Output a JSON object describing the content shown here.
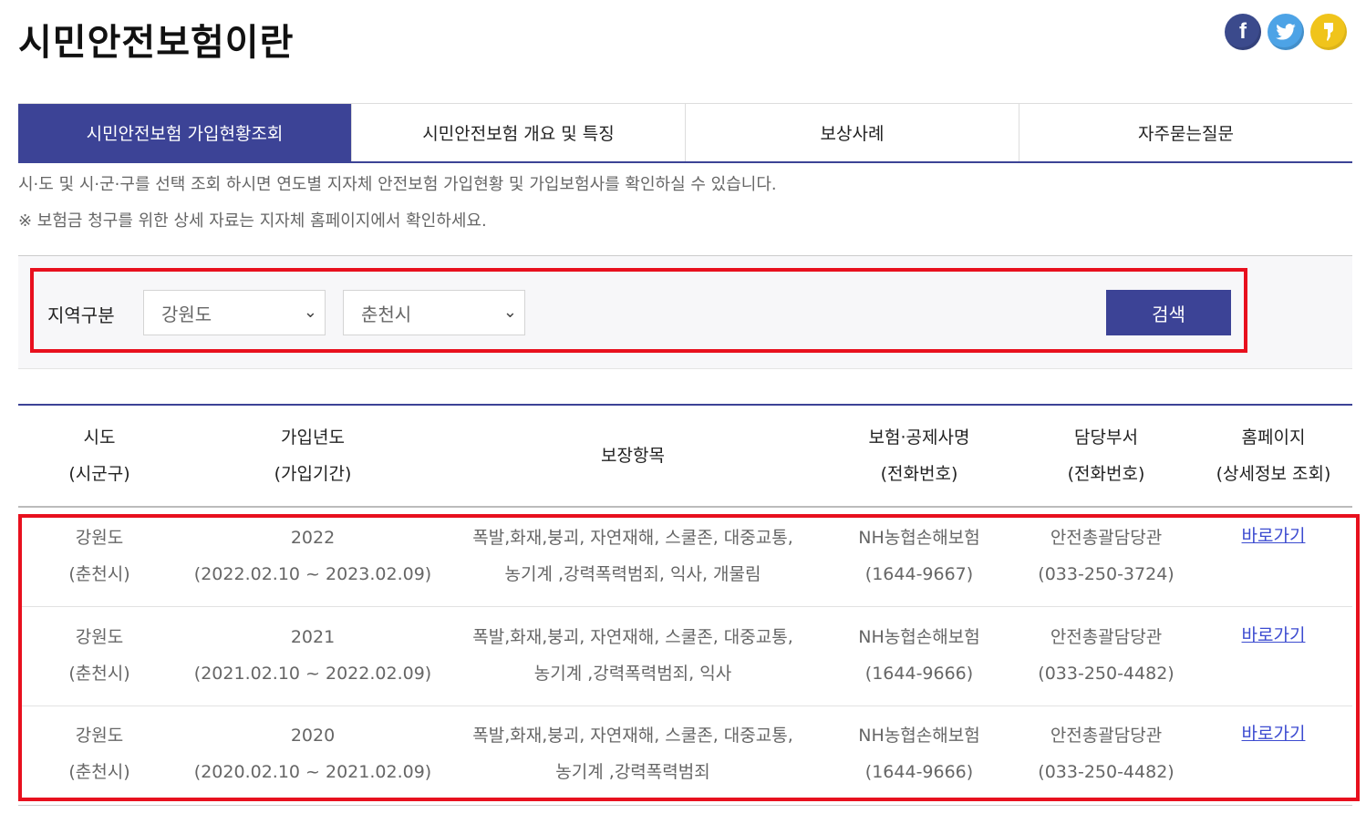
{
  "page": {
    "title": "시민안전보험이란"
  },
  "social": {
    "facebook": "f",
    "twitter": "t",
    "kakao": "k"
  },
  "tabs": [
    {
      "label": "시민안전보험 가입현황조회",
      "active": true
    },
    {
      "label": "시민안전보험 개요 및 특징",
      "active": false
    },
    {
      "label": "보상사례",
      "active": false
    },
    {
      "label": "자주묻는질문",
      "active": false
    }
  ],
  "description": {
    "line1": "시·도 및 시·군·구를 선택 조회 하시면 연도별 지자체 안전보험 가입현황 및 가입보험사를 확인하실 수 있습니다.",
    "line2": "※ 보험금 청구를 위한 상세 자료는 지자체 홈페이지에서 확인하세요."
  },
  "search": {
    "region_label": "지역구분",
    "province": "강원도",
    "city": "춘천시",
    "button_label": "검색"
  },
  "table": {
    "headers": [
      {
        "line1": "시도",
        "line2": "(시군구)"
      },
      {
        "line1": "가입년도",
        "line2": "(가입기간)"
      },
      {
        "line1": "보장항목",
        "line2": ""
      },
      {
        "line1": "보험·공제사명",
        "line2": "(전화번호)"
      },
      {
        "line1": "담당부서",
        "line2": "(전화번호)"
      },
      {
        "line1": "홈페이지",
        "line2": "(상세정보 조회)"
      }
    ],
    "rows": [
      {
        "region": "강원도",
        "subregion": "(춘천시)",
        "year": "2022",
        "period": "(2022.02.10 ~ 2023.02.09)",
        "coverage1": "폭발,화재,붕괴, 자연재해, 스쿨존, 대중교통,",
        "coverage2": "농기계 ,강력폭력범죄, 익사, 개물림",
        "insurer": "NH농협손해보험",
        "insurer_phone": "(1644-9667)",
        "dept": "안전총괄담당관",
        "dept_phone": "(033-250-3724)",
        "link": "바로가기"
      },
      {
        "region": "강원도",
        "subregion": "(춘천시)",
        "year": "2021",
        "period": "(2021.02.10 ~ 2022.02.09)",
        "coverage1": "폭발,화재,붕괴, 자연재해, 스쿨존, 대중교통,",
        "coverage2": "농기계 ,강력폭력범죄, 익사",
        "insurer": "NH농협손해보험",
        "insurer_phone": "(1644-9666)",
        "dept": "안전총괄담당관",
        "dept_phone": "(033-250-4482)",
        "link": "바로가기"
      },
      {
        "region": "강원도",
        "subregion": "(춘천시)",
        "year": "2020",
        "period": "(2020.02.10 ~ 2021.02.09)",
        "coverage1": "폭발,화재,붕괴, 자연재해, 스쿨존, 대중교통,",
        "coverage2": "농기계 ,강력폭력범죄",
        "insurer": "NH농협손해보험",
        "insurer_phone": "(1644-9666)",
        "dept": "안전총괄담당관",
        "dept_phone": "(033-250-4482)",
        "link": "바로가기"
      }
    ]
  },
  "colors": {
    "brand": "#3c4396",
    "highlight": "#e8101e",
    "link": "#3c4bd0"
  }
}
